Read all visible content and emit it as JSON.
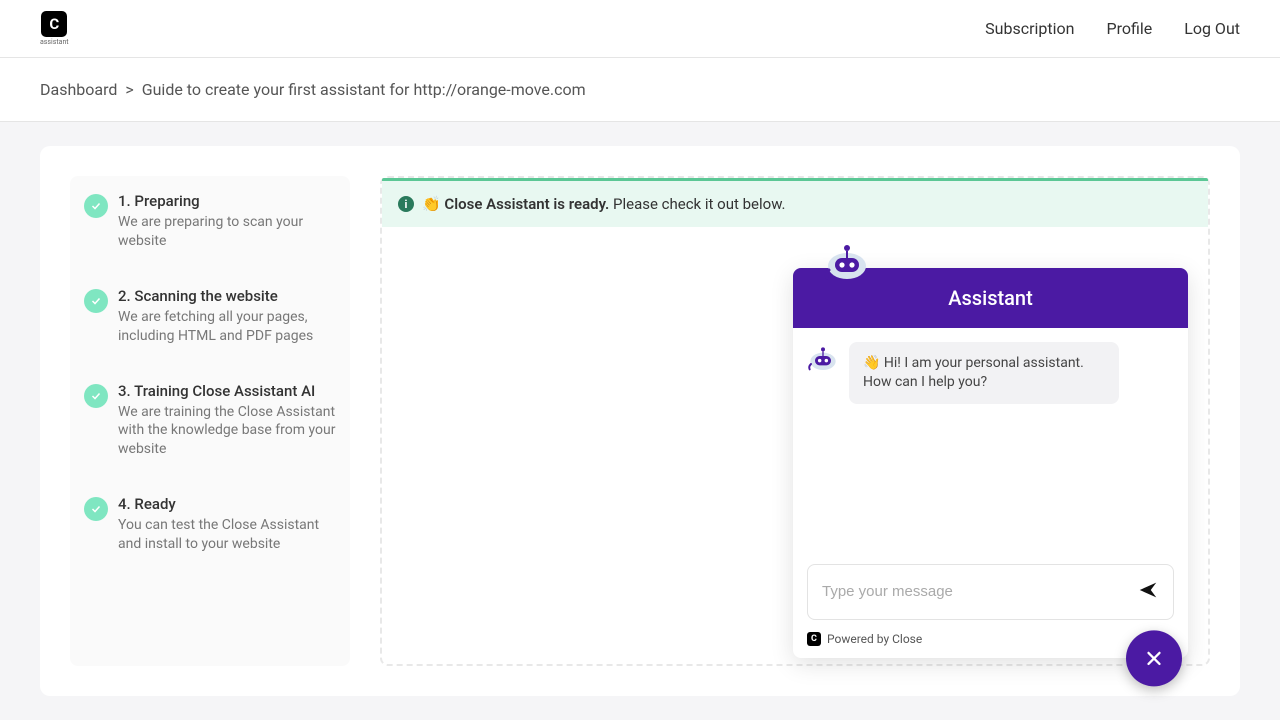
{
  "header": {
    "logo_letter": "C",
    "logo_word": "assistant",
    "nav": {
      "subscription": "Subscription",
      "profile": "Profile",
      "logout": "Log Out"
    }
  },
  "breadcrumb": {
    "dashboard": "Dashboard",
    "sep": ">",
    "current": "Guide to create your first assistant for http://orange-move.com"
  },
  "steps": [
    {
      "title": "1. Preparing",
      "desc": "We are preparing to scan your website"
    },
    {
      "title": "2. Scanning the website",
      "desc": "We are fetching all your pages, including HTML and PDF pages"
    },
    {
      "title": "3. Training Close Assistant AI",
      "desc": "We are training the Close Assistant with the knowledge base from your website"
    },
    {
      "title": "4. Ready",
      "desc": "You can test the Close Assistant and install to your website"
    }
  ],
  "notice": {
    "emoji": "👏",
    "strong": "Close Assistant is ready.",
    "rest": " Please check it out below."
  },
  "chat": {
    "title": "Assistant",
    "greeting": "👋 Hi! I am your personal assistant. How can I help you?",
    "placeholder": "Type your message",
    "powered": "Powered by Close"
  }
}
